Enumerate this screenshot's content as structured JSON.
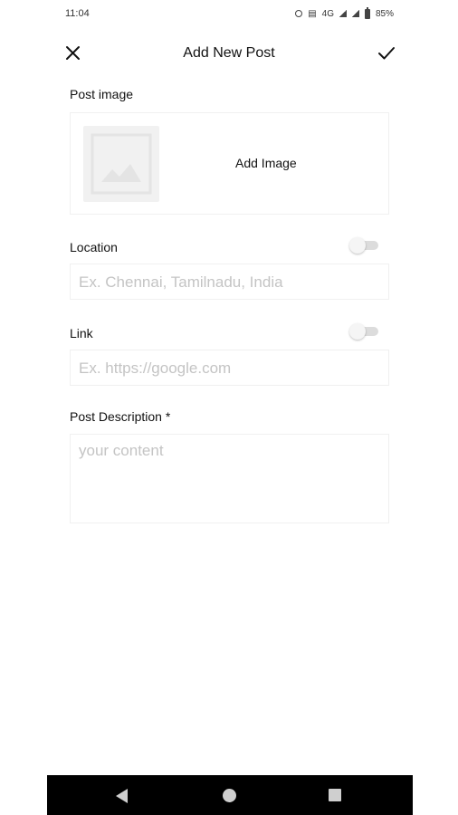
{
  "status_bar": {
    "time": "11:04",
    "network": "4G",
    "battery": "85%"
  },
  "app_bar": {
    "title": "Add New Post",
    "close_icon": "close-icon",
    "confirm_icon": "check-icon"
  },
  "post_image": {
    "label": "Post image",
    "add_image_label": "Add Image"
  },
  "location": {
    "label": "Location",
    "placeholder": "Ex. Chennai, Tamilnadu, India",
    "enabled": false
  },
  "link": {
    "label": "Link",
    "placeholder": "Ex. https://google.com",
    "enabled": false
  },
  "description": {
    "label": "Post Description *",
    "placeholder": "your content"
  },
  "nav": {
    "back_icon": "back-triangle-icon",
    "home_icon": "home-circle-icon",
    "recents_icon": "recents-square-icon"
  }
}
